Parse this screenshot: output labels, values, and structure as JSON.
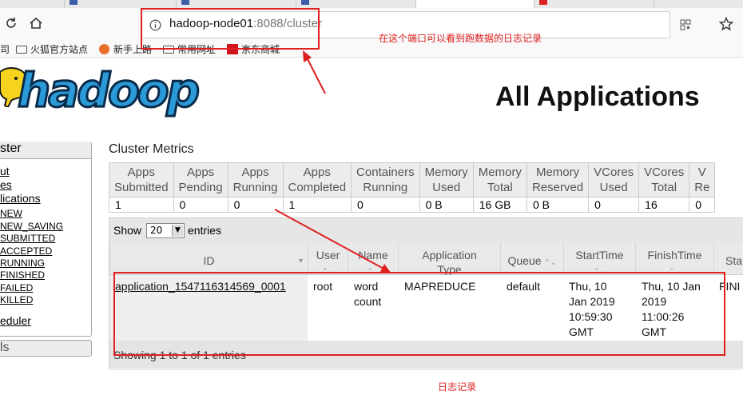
{
  "browser": {
    "url_host": "hadoop-node01",
    "url_rest": ":8088/cluster",
    "bookmarks": [
      "司",
      "火狐官方站点",
      "新手上路",
      "常用网址",
      "京东商城"
    ]
  },
  "page": {
    "title": "All Applications",
    "logo_text": "hadoop"
  },
  "sidebar": {
    "header": "ster",
    "links": [
      "ut",
      "es",
      "lications"
    ],
    "states": [
      "NEW",
      "NEW_SAVING",
      "SUBMITTED",
      "ACCEPTED",
      "RUNNING",
      "FINISHED",
      "FAILED",
      "KILLED"
    ],
    "scheduler": "eduler",
    "tools": "ls"
  },
  "cluster_metrics": {
    "title": "Cluster Metrics",
    "headers": [
      [
        "Apps",
        "Submitted"
      ],
      [
        "Apps",
        "Pending"
      ],
      [
        "Apps",
        "Running"
      ],
      [
        "Apps",
        "Completed"
      ],
      [
        "Containers",
        "Running"
      ],
      [
        "Memory",
        "Used"
      ],
      [
        "Memory",
        "Total"
      ],
      [
        "Memory",
        "Reserved"
      ],
      [
        "VCores",
        "Used"
      ],
      [
        "VCores",
        "Total"
      ],
      [
        "V",
        "Re"
      ]
    ],
    "values": [
      "1",
      "0",
      "0",
      "1",
      "0",
      "0 B",
      "16 GB",
      "0 B",
      "0",
      "16",
      "0"
    ]
  },
  "apps_table": {
    "show_label": "Show",
    "page_size": "20",
    "entries_label": "entries",
    "columns": [
      "ID",
      "User",
      "Name",
      "Application Type",
      "Queue",
      "StartTime",
      "FinishTime",
      "Sta"
    ],
    "row": {
      "id": "application_1547116314569_0001",
      "user": "root",
      "name": "word count",
      "type": "MAPREDUCE",
      "queue": "default",
      "start": "Thu, 10 Jan 2019 10:59:30 GMT",
      "finish": "Thu, 10 Jan 2019 11:00:26 GMT",
      "state": "FINI"
    },
    "footer": "Showing 1 to 1 of 1 entries"
  },
  "annotations": {
    "port_note": "在这个端口可以看到跑数据的日志记录",
    "log_note": "日志记录"
  }
}
